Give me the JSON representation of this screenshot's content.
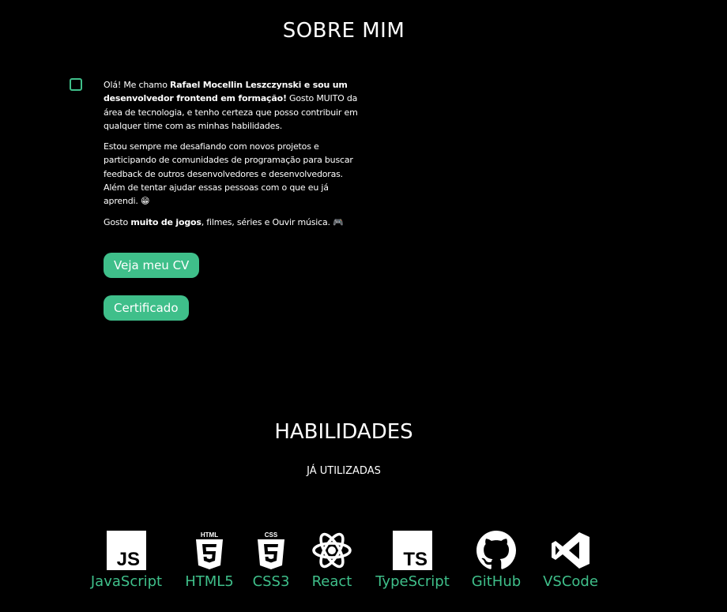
{
  "about": {
    "title": "SOBRE MIM",
    "p1_greeting": "Olá! Me chamo ",
    "p1_bold": "Rafael Mocellin Leszczynski e sou um desenvolvedor frontend em formação!",
    "p1_rest": " Gosto MUITO da área de tecnologia, e tenho certeza que posso contribuir em qualquer time com as minhas habilidades.",
    "p2": "Estou sempre me desafiando com novos projetos e participando de comunidades de programação para buscar feedback de outros desenvolvedores e desenvolvedoras. Além de tentar ajudar essas pessoas com o que eu já aprendi. 😁",
    "p3_start": "Gosto ",
    "p3_bold": "muito de jogos",
    "p3_rest": ", filmes, séries e Ouvir música. 🎮",
    "cv_button": "Veja meu CV",
    "cert_button": "Certificado"
  },
  "skills": {
    "title": "HABILIDADES",
    "subtitle": "JÁ UTILIZADAS",
    "items": [
      {
        "label": "JavaScript",
        "icon": "javascript-icon"
      },
      {
        "label": "HTML5",
        "icon": "html5-icon"
      },
      {
        "label": "CSS3",
        "icon": "css3-icon"
      },
      {
        "label": "React",
        "icon": "react-icon"
      },
      {
        "label": "TypeScript",
        "icon": "typescript-icon"
      },
      {
        "label": "GitHub",
        "icon": "github-icon"
      },
      {
        "label": "VSCode",
        "icon": "vscode-icon"
      }
    ],
    "accent_color": "#3fbf8a"
  }
}
